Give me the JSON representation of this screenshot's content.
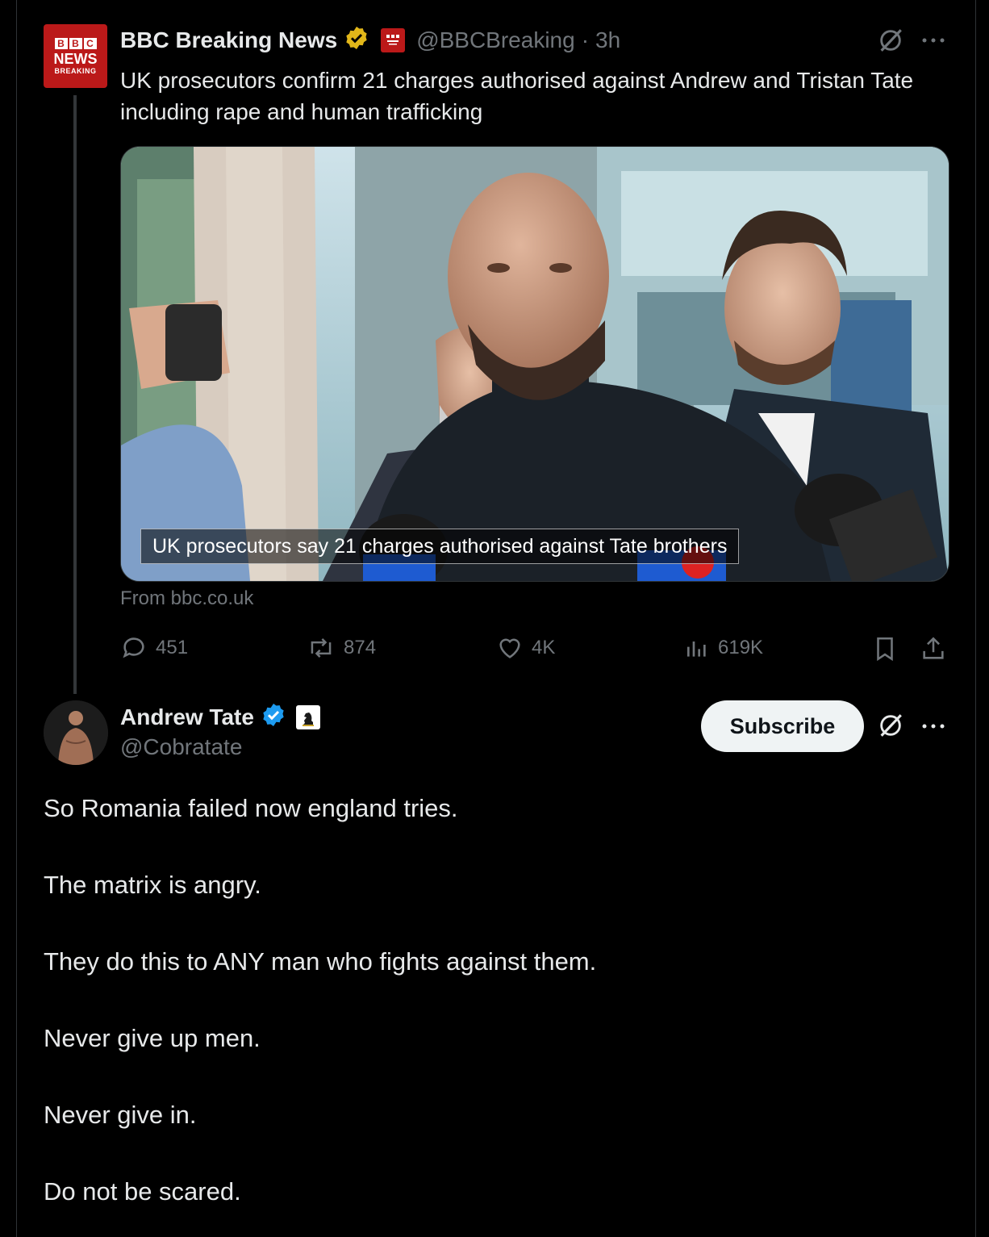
{
  "quoted_tweet": {
    "avatar_text": {
      "blocks": [
        "B",
        "B",
        "C"
      ],
      "news": "NEWS",
      "sub": "BREAKING"
    },
    "display_name": "BBC Breaking News",
    "handle": "@BBCBreaking",
    "separator": "·",
    "time": "3h",
    "text": "UK prosecutors confirm 21 charges authorised against Andrew and Tristan Tate including rape and human trafficking",
    "card": {
      "caption": "UK prosecutors say 21 charges authorised against Tate brothers",
      "source": "From bbc.co.uk"
    },
    "stats": {
      "replies": "451",
      "reposts": "874",
      "likes": "4K",
      "views": "619K"
    }
  },
  "main_tweet": {
    "display_name": "Andrew Tate",
    "handle": "@Cobratate",
    "subscribe_label": "Subscribe",
    "lines": [
      "So Romania failed now england tries.",
      "The matrix is angry.",
      "They do this to ANY man who fights against them.",
      "Never give up men.",
      "Never give in.",
      "Do not be scared."
    ]
  },
  "icons": {
    "verified_gold": "gold-verified-badge-icon",
    "verified_blue": "blue-verified-badge-icon",
    "grok": "grok-icon",
    "more": "more-icon",
    "reply": "reply-icon",
    "repost": "repost-icon",
    "like": "like-icon",
    "views": "views-icon",
    "bookmark": "bookmark-icon",
    "share": "share-icon",
    "knight": "chess-knight-icon"
  },
  "colors": {
    "background": "#000000",
    "text": "#e7e9ea",
    "muted": "#71767b",
    "bbc_red": "#bb1919",
    "verified_blue": "#1d9bf0",
    "verified_gold": "#e2b719"
  }
}
